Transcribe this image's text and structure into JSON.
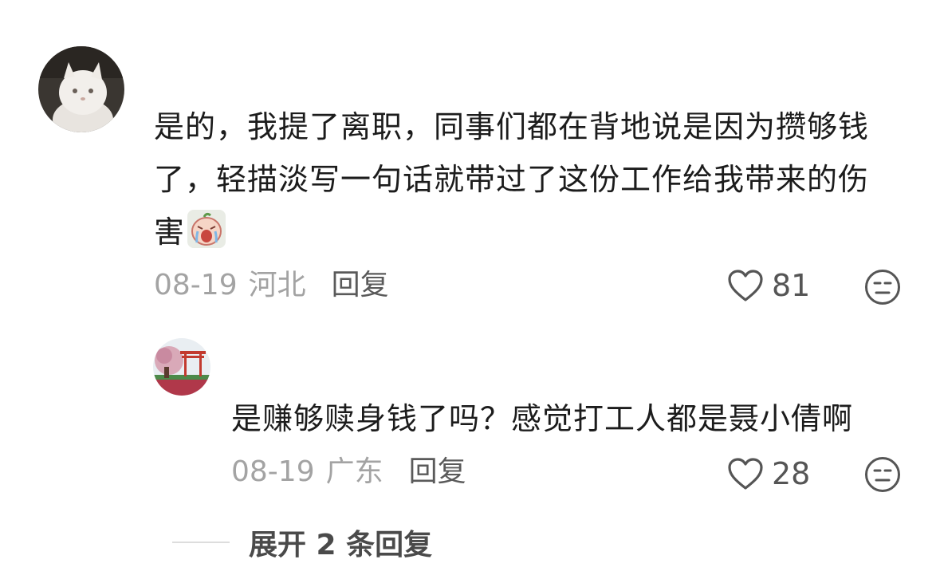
{
  "comment": {
    "text": "是的，我提了离职，同事们都在背地说是因为攒够钱了，轻描淡写一句话就带过了这份工作给我带来的伤害",
    "date": "08-19",
    "region": "河北",
    "reply_label": "回复",
    "like_count": "81"
  },
  "reply": {
    "text": "是赚够赎身钱了吗？感觉打工人都是聂小倩啊",
    "date": "08-19",
    "region": "广东",
    "reply_label": "回复",
    "like_count": "28"
  },
  "expand_label": "展开 2 条回复",
  "icons": {
    "like": "heart-outline-icon",
    "dislike": "unamused-face-icon",
    "inline_emoji": "crying-face-emoji"
  },
  "colors": {
    "text": "#1c1c1c",
    "meta": "#a3a3a3",
    "reply_button": "#5a5a5a",
    "icon": "#555555"
  }
}
